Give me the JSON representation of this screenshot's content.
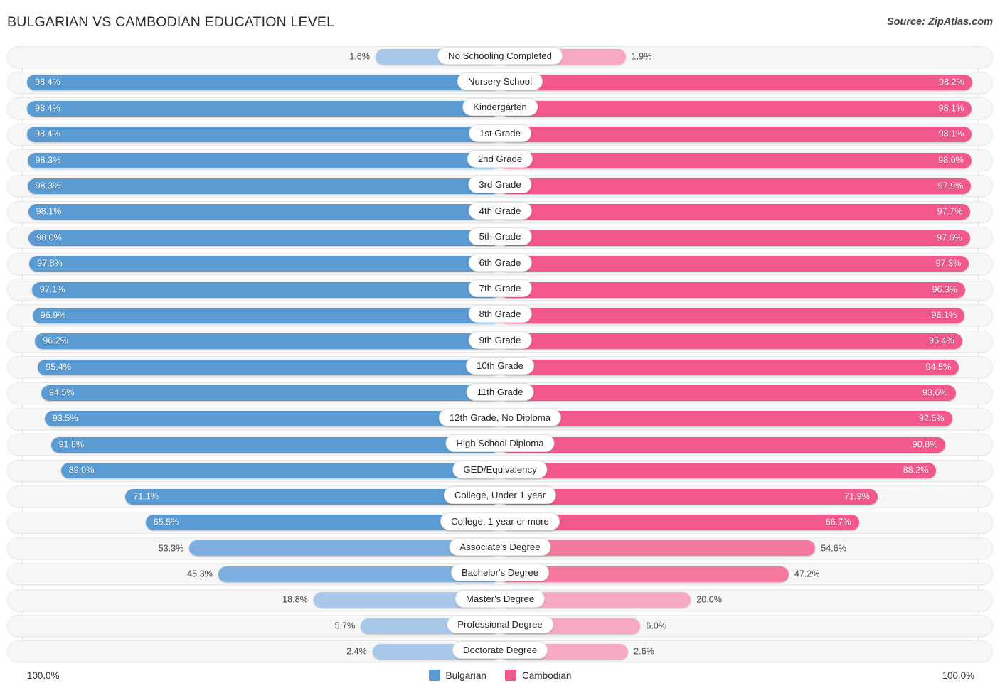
{
  "header": {
    "title": "BULGARIAN VS CAMBODIAN EDUCATION LEVEL",
    "source": "Source: ZipAtlas.com"
  },
  "footer": {
    "axis_left": "100.0%",
    "axis_right": "100.0%",
    "legend": [
      {
        "label": "Bulgarian",
        "color": "#5a9bd4"
      },
      {
        "label": "Cambodian",
        "color": "#f2588c"
      }
    ]
  },
  "colors": {
    "blue_strong": "#5a9bd4",
    "blue_mid": "#7dafe0",
    "blue_light": "#a8c8ea",
    "pink_strong": "#f2588c",
    "pink_mid": "#f5799f",
    "pink_light": "#f7a8c4",
    "track": "#f7f7f7",
    "gridline": "#e6e6e6"
  },
  "chart_data": {
    "type": "bar",
    "title": "BULGARIAN VS CAMBODIAN EDUCATION LEVEL",
    "subtitle": "Source: ZipAtlas.com",
    "orientation": "horizontal-diverging",
    "xlabel": "",
    "ylabel": "",
    "xlim": [
      0,
      100
    ],
    "grid": false,
    "legend_position": "bottom-center",
    "axis_tick_labels": [
      "100.0%",
      "100.0%"
    ],
    "categories": [
      "No Schooling Completed",
      "Nursery School",
      "Kindergarten",
      "1st Grade",
      "2nd Grade",
      "3rd Grade",
      "4th Grade",
      "5th Grade",
      "6th Grade",
      "7th Grade",
      "8th Grade",
      "9th Grade",
      "10th Grade",
      "11th Grade",
      "12th Grade, No Diploma",
      "High School Diploma",
      "GED/Equivalency",
      "College, Under 1 year",
      "College, 1 year or more",
      "Associate's Degree",
      "Bachelor's Degree",
      "Master's Degree",
      "Professional Degree",
      "Doctorate Degree"
    ],
    "series": [
      {
        "name": "Bulgarian",
        "color": "#5a9bd4",
        "values": [
          1.6,
          98.4,
          98.4,
          98.4,
          98.3,
          98.3,
          98.1,
          98.0,
          97.8,
          97.1,
          96.9,
          96.2,
          95.4,
          94.5,
          93.5,
          91.8,
          89.0,
          71.1,
          65.5,
          53.3,
          45.3,
          18.8,
          5.7,
          2.4
        ]
      },
      {
        "name": "Cambodian",
        "color": "#f2588c",
        "values": [
          1.9,
          98.2,
          98.1,
          98.1,
          98.0,
          97.9,
          97.7,
          97.6,
          97.3,
          96.3,
          96.1,
          95.4,
          94.5,
          93.6,
          92.6,
          90.8,
          88.2,
          71.9,
          66.7,
          54.6,
          47.2,
          20.0,
          6.0,
          2.6
        ]
      }
    ]
  },
  "rows": [
    {
      "label": "No Schooling Completed",
      "left": "1.6%",
      "right": "1.9%",
      "lv": 1.6,
      "rv": 1.9
    },
    {
      "label": "Nursery School",
      "left": "98.4%",
      "right": "98.2%",
      "lv": 98.4,
      "rv": 98.2
    },
    {
      "label": "Kindergarten",
      "left": "98.4%",
      "right": "98.1%",
      "lv": 98.4,
      "rv": 98.1
    },
    {
      "label": "1st Grade",
      "left": "98.4%",
      "right": "98.1%",
      "lv": 98.4,
      "rv": 98.1
    },
    {
      "label": "2nd Grade",
      "left": "98.3%",
      "right": "98.0%",
      "lv": 98.3,
      "rv": 98.0
    },
    {
      "label": "3rd Grade",
      "left": "98.3%",
      "right": "97.9%",
      "lv": 98.3,
      "rv": 97.9
    },
    {
      "label": "4th Grade",
      "left": "98.1%",
      "right": "97.7%",
      "lv": 98.1,
      "rv": 97.7
    },
    {
      "label": "5th Grade",
      "left": "98.0%",
      "right": "97.6%",
      "lv": 98.0,
      "rv": 97.6
    },
    {
      "label": "6th Grade",
      "left": "97.8%",
      "right": "97.3%",
      "lv": 97.8,
      "rv": 97.3
    },
    {
      "label": "7th Grade",
      "left": "97.1%",
      "right": "96.3%",
      "lv": 97.1,
      "rv": 96.3
    },
    {
      "label": "8th Grade",
      "left": "96.9%",
      "right": "96.1%",
      "lv": 96.9,
      "rv": 96.1
    },
    {
      "label": "9th Grade",
      "left": "96.2%",
      "right": "95.4%",
      "lv": 96.2,
      "rv": 95.4
    },
    {
      "label": "10th Grade",
      "left": "95.4%",
      "right": "94.5%",
      "lv": 95.4,
      "rv": 94.5
    },
    {
      "label": "11th Grade",
      "left": "94.5%",
      "right": "93.6%",
      "lv": 94.5,
      "rv": 93.6
    },
    {
      "label": "12th Grade, No Diploma",
      "left": "93.5%",
      "right": "92.6%",
      "lv": 93.5,
      "rv": 92.6
    },
    {
      "label": "High School Diploma",
      "left": "91.8%",
      "right": "90.8%",
      "lv": 91.8,
      "rv": 90.8
    },
    {
      "label": "GED/Equivalency",
      "left": "89.0%",
      "right": "88.2%",
      "lv": 89.0,
      "rv": 88.2
    },
    {
      "label": "College, Under 1 year",
      "left": "71.1%",
      "right": "71.9%",
      "lv": 71.1,
      "rv": 71.9
    },
    {
      "label": "College, 1 year or more",
      "left": "65.5%",
      "right": "66.7%",
      "lv": 65.5,
      "rv": 66.7
    },
    {
      "label": "Associate's Degree",
      "left": "53.3%",
      "right": "54.6%",
      "lv": 53.3,
      "rv": 54.6
    },
    {
      "label": "Bachelor's Degree",
      "left": "45.3%",
      "right": "47.2%",
      "lv": 45.3,
      "rv": 47.2
    },
    {
      "label": "Master's Degree",
      "left": "18.8%",
      "right": "20.0%",
      "lv": 18.8,
      "rv": 20.0
    },
    {
      "label": "Professional Degree",
      "left": "5.7%",
      "right": "6.0%",
      "lv": 5.7,
      "rv": 6.0
    },
    {
      "label": "Doctorate Degree",
      "left": "2.4%",
      "right": "2.6%",
      "lv": 2.4,
      "rv": 2.6
    }
  ]
}
